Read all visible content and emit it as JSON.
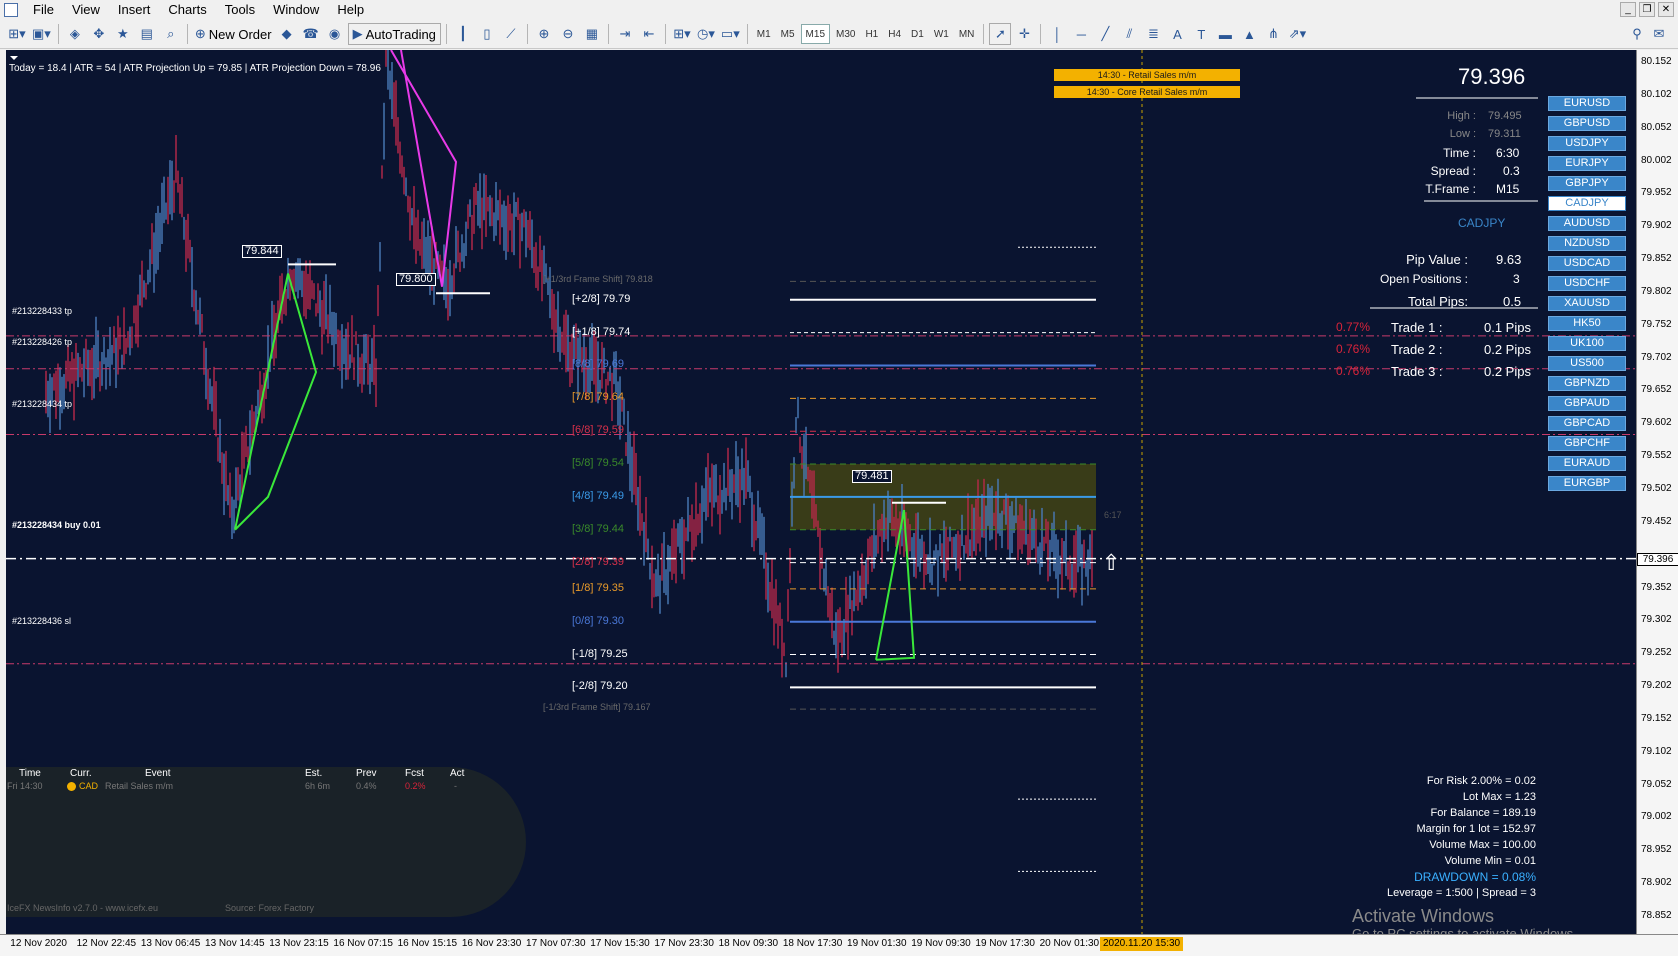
{
  "menubar": {
    "items": [
      "File",
      "View",
      "Insert",
      "Charts",
      "Tools",
      "Window",
      "Help"
    ]
  },
  "toolbar": {
    "new_order": "New Order",
    "autotrading": "AutoTrading",
    "timeframes": [
      "M1",
      "M5",
      "M15",
      "M30",
      "H1",
      "H4",
      "D1",
      "W1",
      "MN"
    ],
    "active_timeframe": "M15"
  },
  "chart": {
    "header": "Today = 18.4   |   ATR = 54   |   ATR Projection Up = 79.85   |   ATR Projection Down = 78.96",
    "big_price": "79.396",
    "info": {
      "high_label": "High :",
      "high_value": "79.495",
      "low_label": "Low :",
      "low_value": "79.311",
      "time_label": "Time :",
      "time_value": "6:30",
      "spread_label": "Spread :",
      "spread_value": "0.3",
      "tframe_label": "T.Frame :",
      "tframe_value": "M15",
      "symbol": "CADJPY",
      "pip_label": "Pip Value :",
      "pip_value": "9.63",
      "open_label": "Open Positions :",
      "open_value": "3",
      "total_label": "Total Pips:",
      "total_value": "0.5"
    },
    "trades": [
      {
        "pct": "0.77%",
        "label": "Trade 1 :",
        "pips": "0.1 Pips"
      },
      {
        "pct": "0.76%",
        "label": "Trade 2 :",
        "pips": "0.2 Pips"
      },
      {
        "pct": "0.76%",
        "label": "Trade 3 :",
        "pips": "0.2 Pips"
      }
    ],
    "symbols": [
      "EURUSD",
      "GBPUSD",
      "USDJPY",
      "EURJPY",
      "GBPJPY",
      "CADJPY",
      "AUDUSD",
      "NZDUSD",
      "USDCAD",
      "USDCHF",
      "XAUUSD",
      "HK50",
      "UK100",
      "US500",
      "GBPNZD",
      "GBPAUD",
      "GBPCAD",
      "GBPCHF",
      "EURAUD",
      "EURGBP"
    ],
    "selected_symbol": "CADJPY",
    "news_bars": [
      "14:30 - Retail Sales m/m",
      "14:30 - Core Retail Sales m/m"
    ],
    "murray": [
      {
        "label": "[+1/3rd Frame Shift]  79.818",
        "color": "#6a6a6a"
      },
      {
        "label": "[+2/8]  79.79",
        "color": "#ffffff"
      },
      {
        "label": "[+1/8]  79.74",
        "color": "#ffffff"
      },
      {
        "label": "[8/8]  79.69",
        "color": "#4a78d8"
      },
      {
        "label": "[7/8]  79.64",
        "color": "#e89a2a"
      },
      {
        "label": "[6/8]  79.59",
        "color": "#d8304a"
      },
      {
        "label": "[5/8]  79.54",
        "color": "#3a8a2a"
      },
      {
        "label": "[4/8]  79.49",
        "color": "#3a9ae8"
      },
      {
        "label": "[3/8]  79.44",
        "color": "#3a8a2a"
      },
      {
        "label": "[2/8]  79.39",
        "color": "#d8304a"
      },
      {
        "label": "[1/8]  79.35",
        "color": "#e89a2a"
      },
      {
        "label": "[0/8]  79.30",
        "color": "#4a78d8"
      },
      {
        "label": "[-1/8]  79.25",
        "color": "#ffffff"
      },
      {
        "label": "[-2/8]  79.20",
        "color": "#ffffff"
      },
      {
        "label": "[-1/3rd Frame Shift]  79.167",
        "color": "#6a6a6a"
      }
    ],
    "hlines": [
      "#213228433 tp",
      "#213228426 tp",
      "#213228434 tp",
      "#213228434 buy 0.01",
      "#213228436 sl"
    ],
    "box_labels": [
      "79.844",
      "79.800",
      "79.481"
    ],
    "candle_timer": "6:17",
    "risk": [
      "For Risk 2.00% = 0.02",
      "Lot Max = 1.23",
      "For Balance = 189.19",
      "Margin for 1 lot = 152.97",
      "Volume Max = 100.00",
      "Volume Min = 0.01",
      "DRAWDOWN =  0.08%",
      "Leverage = 1:500 | Spread = 3"
    ],
    "watermark_title": "Activate Windows",
    "watermark_sub": "Go to PC settings to activate Windows.",
    "news_panel": {
      "headers": [
        "Time",
        "Curr.",
        "Event",
        "Est.",
        "Prev",
        "Fcst",
        "Act"
      ],
      "row": [
        "Fri   14:30",
        "CAD",
        "Retail Sales m/m",
        "6h 6m",
        "0.4%",
        "0.2%",
        "-"
      ],
      "footer_left": "IceFX NewsInfo v2.7.0  -  www.icefx.eu",
      "footer_right": "Source: Forex Factory"
    }
  },
  "price_axis": [
    "80.152",
    "80.102",
    "80.052",
    "80.002",
    "79.952",
    "79.902",
    "79.852",
    "79.802",
    "79.752",
    "79.702",
    "79.652",
    "79.602",
    "79.552",
    "79.502",
    "79.452",
    "79.396",
    "79.352",
    "79.302",
    "79.252",
    "79.202",
    "79.152",
    "79.102",
    "79.052",
    "79.002",
    "78.952",
    "78.902",
    "78.852"
  ],
  "current_price_axis": "79.396",
  "time_axis": [
    "12 Nov 2020",
    "12 Nov 22:45",
    "13 Nov 06:45",
    "13 Nov 14:45",
    "13 Nov 23:15",
    "16 Nov 07:15",
    "16 Nov 15:15",
    "16 Nov 23:30",
    "17 Nov 07:30",
    "17 Nov 15:30",
    "17 Nov 23:30",
    "18 Nov 09:30",
    "18 Nov 17:30",
    "19 Nov 01:30",
    "19 Nov 09:30",
    "19 Nov 17:30",
    "20 Nov 01:30"
  ],
  "time_cursor": "2020.11.20 15:30"
}
